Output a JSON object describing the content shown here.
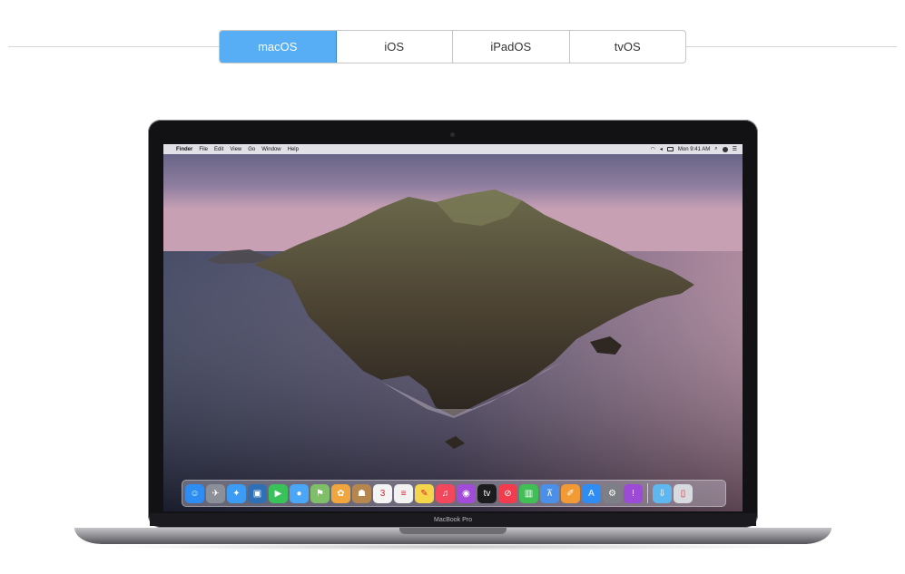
{
  "tabs": [
    {
      "label": "macOS",
      "active": true
    },
    {
      "label": "iOS",
      "active": false
    },
    {
      "label": "iPadOS",
      "active": false
    },
    {
      "label": "tvOS",
      "active": false
    }
  ],
  "colors": {
    "active_tab": "#58aef5",
    "divider": "#d6d6d6"
  },
  "device": {
    "brand_label": "MacBook Pro"
  },
  "menubar": {
    "apple": "",
    "app": "Finder",
    "items": [
      "File",
      "Edit",
      "View",
      "Go",
      "Window",
      "Help"
    ],
    "clock": "Mon 9:41 AM"
  },
  "dock": {
    "apps": [
      {
        "name": "finder-icon",
        "glyph": "☺",
        "color": "#2d8df2"
      },
      {
        "name": "launchpad-icon",
        "glyph": "✈",
        "color": "#8a8f98"
      },
      {
        "name": "safari-icon",
        "glyph": "✦",
        "color": "#3b9cf5"
      },
      {
        "name": "photo-booth-icon",
        "glyph": "▣",
        "color": "#2f6fb5"
      },
      {
        "name": "facetime-icon",
        "glyph": "▶",
        "color": "#3ac25a"
      },
      {
        "name": "messages-icon",
        "glyph": "●",
        "color": "#4aa6f6"
      },
      {
        "name": "maps-icon",
        "glyph": "⚑",
        "color": "#7fbf6a"
      },
      {
        "name": "photos-icon",
        "glyph": "✿",
        "color": "#f0a63c"
      },
      {
        "name": "contacts-icon",
        "glyph": "☗",
        "color": "#b6864f"
      },
      {
        "name": "calendar-icon",
        "glyph": "3",
        "color": "#f4f4f4"
      },
      {
        "name": "reminders-icon",
        "glyph": "≡",
        "color": "#f2f2f2"
      },
      {
        "name": "notes-icon",
        "glyph": "✎",
        "color": "#f5d64a"
      },
      {
        "name": "music-icon",
        "glyph": "♫",
        "color": "#f2475c"
      },
      {
        "name": "podcasts-icon",
        "glyph": "◉",
        "color": "#a24bd9"
      },
      {
        "name": "tv-icon",
        "glyph": "tv",
        "color": "#1c1c1e"
      },
      {
        "name": "news-icon",
        "glyph": "⊘",
        "color": "#f23b4c"
      },
      {
        "name": "numbers-icon",
        "glyph": "▥",
        "color": "#3fbf55"
      },
      {
        "name": "keynote-icon",
        "glyph": "⊼",
        "color": "#4a8fe8"
      },
      {
        "name": "pages-icon",
        "glyph": "✐",
        "color": "#f29b34"
      },
      {
        "name": "app-store-icon",
        "glyph": "A",
        "color": "#2e8cf2"
      },
      {
        "name": "system-preferences-icon",
        "glyph": "⚙",
        "color": "#7c7f86"
      },
      {
        "name": "feedback-icon",
        "glyph": "!",
        "color": "#9b4bd6"
      }
    ],
    "extras": [
      {
        "name": "downloads-folder-icon",
        "glyph": "⇩",
        "color": "#5fb7f0"
      },
      {
        "name": "trash-icon",
        "glyph": "▯",
        "color": "#d7dbe0"
      }
    ]
  }
}
